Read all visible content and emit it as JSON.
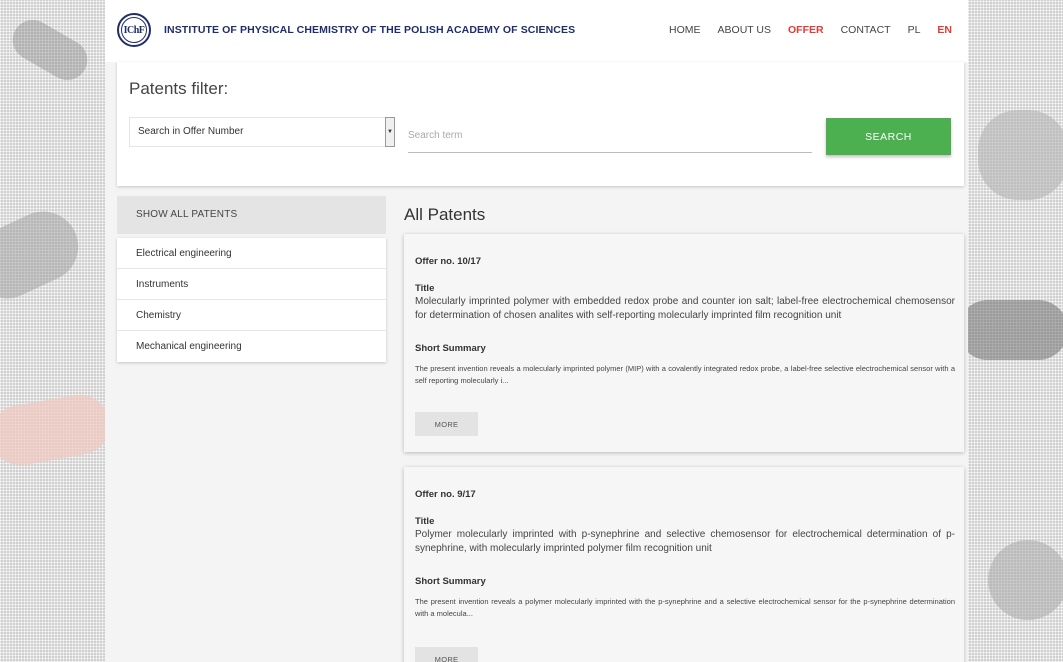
{
  "header": {
    "logo_text": "IChF",
    "institute_name": "INSTITUTE OF PHYSICAL CHEMISTRY OF THE POLISH ACADEMY OF SCIENCES",
    "nav": [
      {
        "label": "HOME"
      },
      {
        "label": "ABOUT US"
      },
      {
        "label": "OFFER"
      },
      {
        "label": "CONTACT"
      },
      {
        "label": "PL"
      },
      {
        "label": "EN"
      }
    ],
    "active_nav": "OFFER",
    "active_lang": "EN",
    "accent_color": "#e53935",
    "brand_color": "#1f2d6b"
  },
  "filter": {
    "title": "Patents filter:",
    "select_value": "Search in Offer Number",
    "search_placeholder": "Search term",
    "search_button": "SEARCH",
    "button_color": "#4caf50"
  },
  "sidebar": {
    "show_all": "SHOW ALL PATENTS",
    "categories": [
      {
        "label": "Electrical engineering"
      },
      {
        "label": "Instruments"
      },
      {
        "label": "Chemistry"
      },
      {
        "label": "Mechanical engineering"
      }
    ]
  },
  "main": {
    "heading": "All Patents",
    "cards": [
      {
        "offer_no": "Offer no. 10/17",
        "title_label": "Title",
        "title": "Molecularly imprinted polymer with embedded redox probe and counter ion salt; label-free electrochemical chemosensor for determination of chosen analites with self-reporting molecularly imprinted film recognition unit",
        "summary_label": "Short Summary",
        "summary": "The present invention reveals a molecularly imprinted polymer (MIP) with a covalently integrated redox probe, a label-free selective electrochemical sensor with a self reporting molecularly i...",
        "more": "MORE"
      },
      {
        "offer_no": "Offer no. 9/17",
        "title_label": "Title",
        "title": "Polymer molecularly imprinted with p-synephrine and selective chemosensor for electrochemical determination of p-synephrine, with molecularly imprinted polymer film recognition unit",
        "summary_label": "Short Summary",
        "summary": "The present invention reveals a  polymer molecularly imprinted with the p-synephrine and a selective electrochemical sensor for the p-synephrine determination with a molecula...",
        "more": "MORE"
      }
    ]
  }
}
